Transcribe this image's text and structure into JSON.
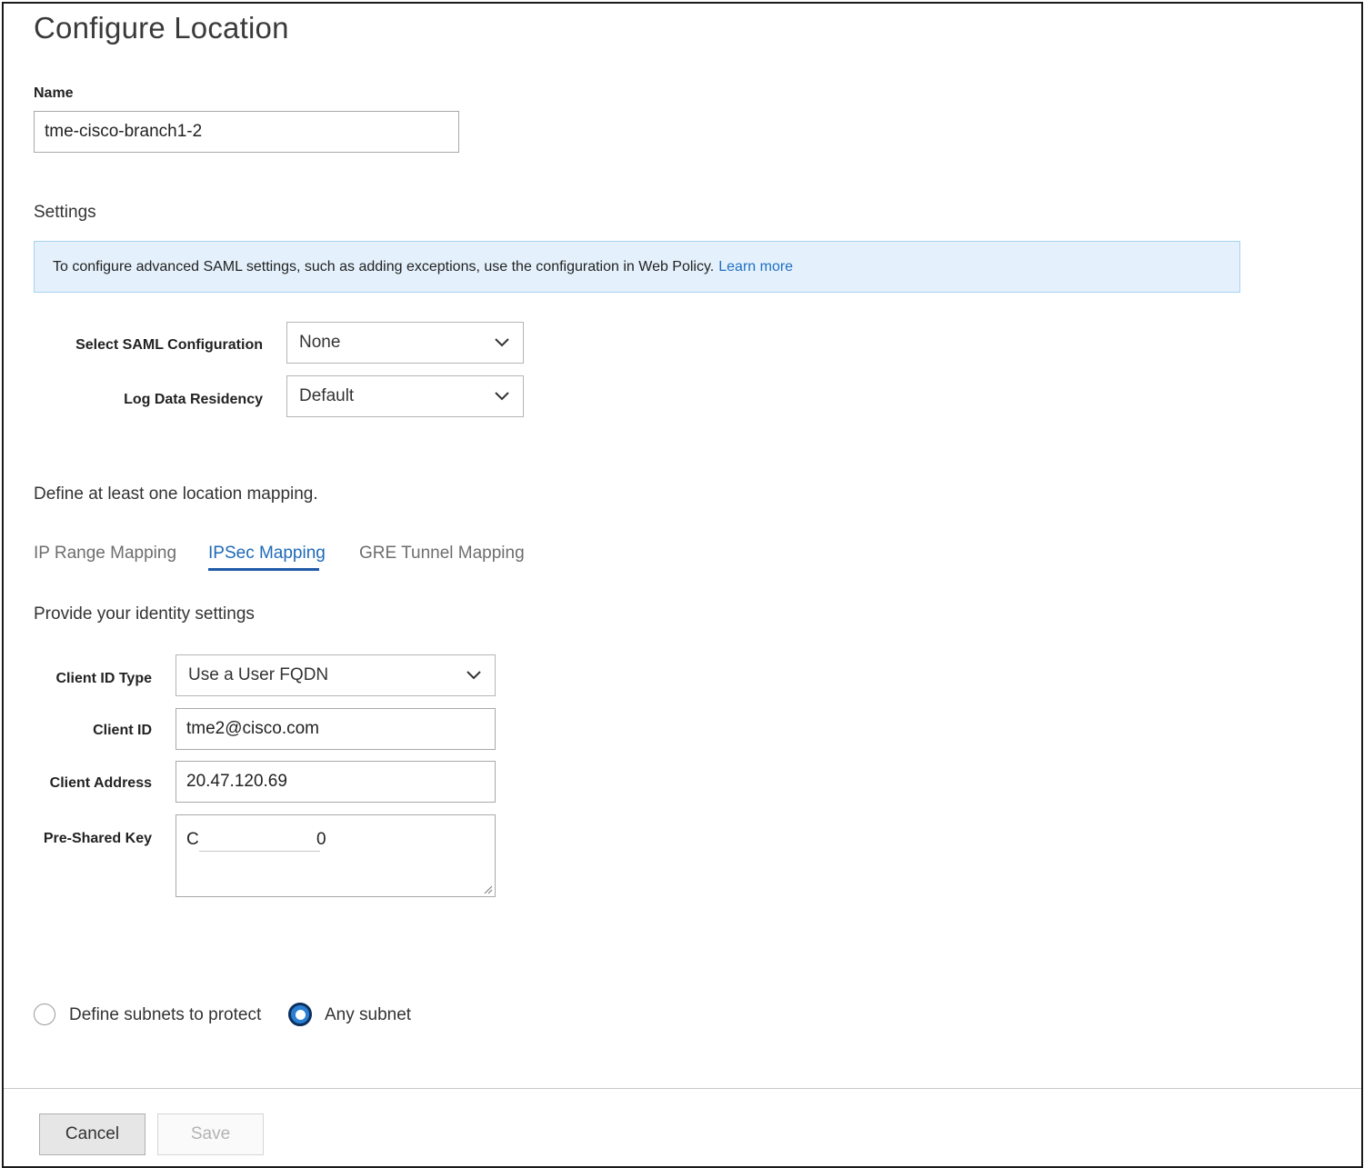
{
  "page": {
    "title": "Configure Location"
  },
  "name_field": {
    "label": "Name",
    "value": "tme-cisco-branch1-2"
  },
  "settings": {
    "heading": "Settings",
    "banner": {
      "text": "To configure advanced SAML settings, such as adding exceptions, use the configuration in Web Policy.",
      "link": "Learn more"
    },
    "saml": {
      "label": "Select SAML Configuration",
      "value": "None"
    },
    "residency": {
      "label": "Log Data Residency",
      "value": "Default"
    }
  },
  "mapping": {
    "heading": "Define at least one location mapping.",
    "tabs": [
      {
        "label": "IP Range Mapping",
        "active": false
      },
      {
        "label": "IPSec Mapping",
        "active": true
      },
      {
        "label": "GRE Tunnel Mapping",
        "active": false
      }
    ]
  },
  "identity": {
    "heading": "Provide your identity settings",
    "client_id_type": {
      "label": "Client ID Type",
      "value": "Use a User FQDN"
    },
    "client_id": {
      "label": "Client ID",
      "value": "tme2@cisco.com"
    },
    "client_address": {
      "label": "Client Address",
      "value": "20.47.120.69"
    },
    "pre_shared_key": {
      "label": "Pre-Shared Key",
      "value_start": "C",
      "value_end": "0"
    }
  },
  "subnets": {
    "options": [
      {
        "label": "Define subnets to protect",
        "selected": false
      },
      {
        "label": "Any subnet",
        "selected": true
      }
    ]
  },
  "footer": {
    "cancel": "Cancel",
    "save": "Save"
  },
  "colors": {
    "accent": "#1e6ab8",
    "banner_bg": "#e4f1fc",
    "radio_selected": "#2a7fd3"
  }
}
